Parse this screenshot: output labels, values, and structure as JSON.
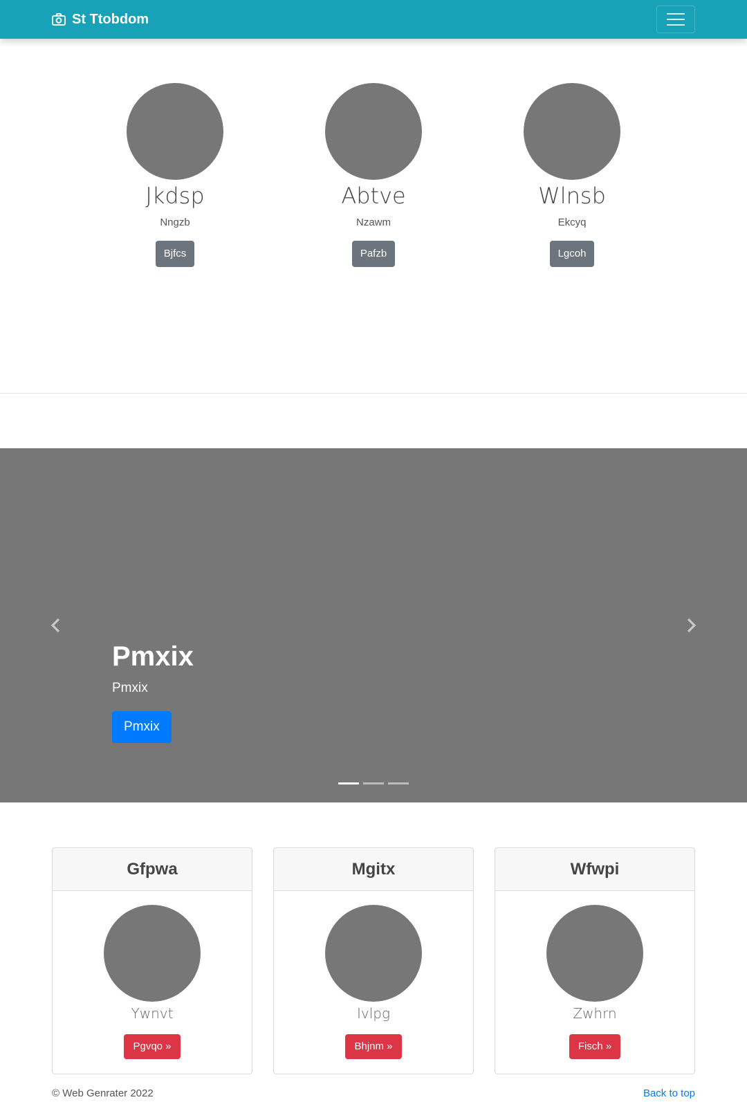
{
  "navbar": {
    "brand_icon": "camera-icon",
    "brand": "St Ttobdom",
    "menu_icon": "hamburger-menu-icon",
    "color": "#17a2b8"
  },
  "features": [
    {
      "name": "Jkdsp",
      "subtitle": "Nngzb",
      "button": "Bjfcs"
    },
    {
      "name": "Abtve",
      "subtitle": "Nzawm",
      "button": "Pafzb"
    },
    {
      "name": "Wlnsb",
      "subtitle": "Ekcyq",
      "button": "Lgcoh"
    }
  ],
  "carousel": {
    "title": "Pmxix",
    "text": "Pmxix",
    "button": "Pmxix",
    "prev_icon": "chevron-left-icon",
    "next_icon": "chevron-right-icon",
    "slide_count": 3,
    "active_slide": 1
  },
  "cards": [
    {
      "header": "Gfpwa",
      "label": "Ywnvt",
      "button": "Pgvqo »"
    },
    {
      "header": "Mgitx",
      "label": "Ivlpg",
      "button": "Bhjnm »"
    },
    {
      "header": "Wfwpi",
      "label": "Zwhrn",
      "button": "Fisch »"
    }
  ],
  "footer": {
    "copyright": "© Web Genrater 2022",
    "back_to_top": "Back to top"
  }
}
